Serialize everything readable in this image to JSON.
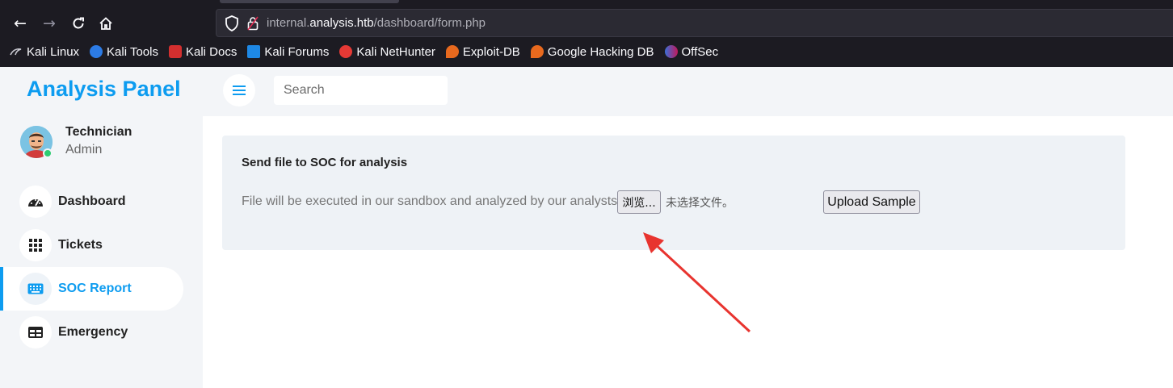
{
  "browser": {
    "url_prefix": "internal.",
    "url_host": "analysis.htb",
    "url_path": "/dashboard/form.php",
    "icons": [
      "back-icon",
      "forward-icon",
      "reload-icon",
      "home-icon",
      "shield-icon",
      "lock-icon"
    ],
    "bookmarks": [
      {
        "label": "Kali Linux",
        "icon": "kali-dragon-icon"
      },
      {
        "label": "Kali Tools",
        "icon": "kali-tools-icon"
      },
      {
        "label": "Kali Docs",
        "icon": "kali-docs-icon"
      },
      {
        "label": "Kali Forums",
        "icon": "kali-forums-icon"
      },
      {
        "label": "Kali NetHunter",
        "icon": "nethunter-icon"
      },
      {
        "label": "Exploit-DB",
        "icon": "exploitdb-icon"
      },
      {
        "label": "Google Hacking DB",
        "icon": "ghdb-icon"
      },
      {
        "label": "OffSec",
        "icon": "offsec-icon"
      }
    ]
  },
  "sidebar": {
    "brand": "Analysis Panel",
    "profile": {
      "name": "Technician",
      "role": "Admin"
    },
    "items": [
      {
        "label": "Dashboard",
        "icon": "speedometer-icon",
        "active": false
      },
      {
        "label": "Tickets",
        "icon": "grid-icon",
        "active": false
      },
      {
        "label": "SOC Report",
        "icon": "keyboard-icon",
        "active": true
      },
      {
        "label": "Emergency",
        "icon": "table-icon",
        "active": false
      }
    ]
  },
  "topbar": {
    "search_placeholder": "Search"
  },
  "form": {
    "title": "Send file to SOC for analysis",
    "description": "File will be executed in our sandbox and analyzed by our analysts",
    "browse_label": "浏览...",
    "no_file_text": "未选择文件。",
    "upload_label": "Upload Sample"
  },
  "colors": {
    "accent": "#0d9cf0",
    "annotation_arrow": "#e8342f"
  }
}
